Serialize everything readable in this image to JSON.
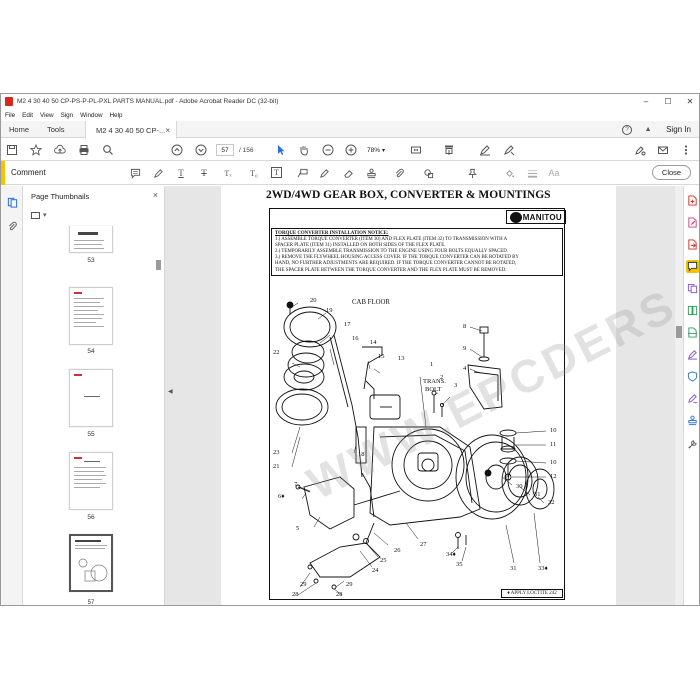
{
  "window": {
    "title": "M2 4 30 40 50 CP-PS-P-PL-PXL PARTS MANUAL.pdf - Adobe Acrobat Reader DC (32-bit)",
    "minimize": "–",
    "maximize": "☐",
    "close": "✕"
  },
  "menu": [
    "File",
    "Edit",
    "View",
    "Sign",
    "Window",
    "Help"
  ],
  "tabs": {
    "home": "Home",
    "tools": "Tools",
    "document": "M2 4 30 40 50 CP-...",
    "close": "×",
    "help_icon": "?",
    "bell_icon": "▲",
    "signin": "Sign In"
  },
  "toolbar": {
    "current_page": "57",
    "total_pages": "/ 156",
    "zoom": "78%",
    "zoom_caret": "▾"
  },
  "comment_bar": {
    "label": "Comment",
    "close": "Close"
  },
  "thumbnails": {
    "title": "Page Thumbnails",
    "close": "×",
    "options_caret": "▾",
    "pages": [
      "53",
      "54",
      "55",
      "56",
      "57"
    ],
    "selected": "57"
  },
  "document": {
    "heading": "2WD/4WD GEAR BOX, CONVERTER & MOUNTINGS",
    "logo": "MANITOU",
    "notice_title": "TORQUE CONVERTER INSTALLATION NOTICE:",
    "notice_lines": [
      "1.) ASSEMBLE TORQUE CONVERTER (ITEM 30) AND FLEX PLATE (ITEM 32) TO TRANSMISSION WITH A",
      "SPACER PLATE (ITEM 31) INSTALLED ON BOTH SIDES OF THE FLEX PLATE.",
      "2.) TEMPORARILY ASSEMBLE TRANSMISSION TO THE ENGINE USING FOUR BOLTS EQUALLY SPACED.",
      "3.) REMOVE THE FLYWHEEL HOUSING ACCESS COVER.  IF THE TORQUE CONVERTER CAN BE ROTATED BY",
      "HAND, NO FURTHER ADJUSTMENTS ARE REQUIRED.  IF THE TORQUE CONVERTER CANNOT BE ROTATED,",
      "THE SPACER PLATE BETWEEN THE TORQUE CONVERTER AND THE FLEX PLATE MUST BE REMOVED."
    ],
    "label_cab_floor": "CAB FLOOR",
    "label_trans_bolt_1": "TRANS.",
    "label_trans_bolt_2": "BOLT",
    "legend": "♦ APPLY LOCTITE 242",
    "watermark": "WWW.EPCDERS.COM",
    "callouts": {
      "c20": "20",
      "c19": "19",
      "c17": "17",
      "c22": "22",
      "c16": "16",
      "c14": "14",
      "c15": "15",
      "c13": "13",
      "c1": "1",
      "c2": "2",
      "c3": "3",
      "c8": "8",
      "c9": "9",
      "c4": "4",
      "c10a": "10",
      "c11": "11",
      "c10b": "10",
      "c12": "12",
      "c21": "21",
      "c23": "23",
      "c18": "18",
      "c7": "7",
      "c6": "6♦",
      "c5": "5",
      "c30": "30",
      "c31a": "31",
      "c32": "32",
      "c27": "27",
      "c26": "26",
      "c25": "25",
      "c24": "24",
      "c34": "34♦",
      "c35": "35",
      "c31b": "31",
      "c33": "33♦",
      "c29a": "29",
      "c28a": "28",
      "c29b": "29",
      "c28b": "28"
    }
  },
  "colors": {
    "accent_yellow": "#f2c400",
    "pdf_red": "#d42b1e",
    "tool_blue": "#2c6fd8",
    "tool_purple": "#8a4fc9",
    "tool_green": "#2e9e5b",
    "tool_pink": "#d43a78"
  }
}
